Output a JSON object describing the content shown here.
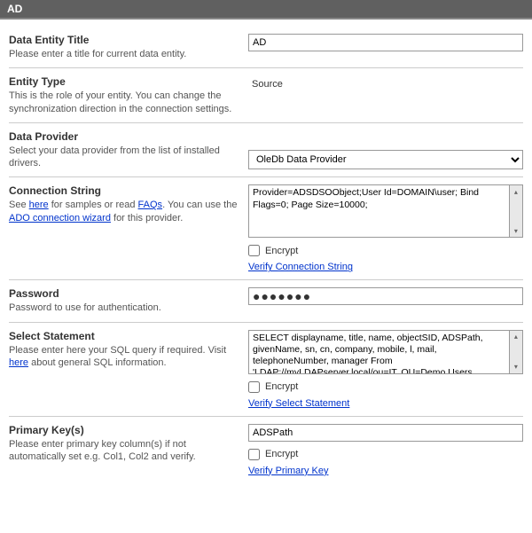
{
  "titleBar": "AD",
  "sections": {
    "dataEntityTitle": {
      "label": "Data Entity Title",
      "desc": "Please enter a title for current data entity.",
      "value": "AD"
    },
    "entityType": {
      "label": "Entity Type",
      "desc": "This is the role of your entity. You can change the synchronization direction in the connection settings.",
      "value": "Source"
    },
    "dataProvider": {
      "label": "Data Provider",
      "desc": "Select your data provider from the list of installed drivers.",
      "value": "OleDb Data Provider"
    },
    "connectionString": {
      "label": "Connection String",
      "descParts": {
        "see": "See ",
        "hereLink1": "here",
        "forSamples": " for samples or read ",
        "faqs": "FAQs",
        "youCanUse": ". You can use the ",
        "wizardLink": "ADO connection wizard",
        "forProvider": " for this provider."
      },
      "value": "Provider=ADSDSOObject;User Id=DOMAIN\\user; Bind Flags=0; Page Size=10000;",
      "encryptLabel": "Encrypt",
      "verifyLink": "Verify Connection String"
    },
    "password": {
      "label": "Password",
      "desc": "Password to use for authentication.",
      "value": "●●●●●●●"
    },
    "selectStatement": {
      "label": "Select Statement",
      "descParts": {
        "pre": "Please enter here your SQL query if required. Visit ",
        "hereLink": "here",
        "post": " about general SQL information."
      },
      "value": "SELECT displayname, title, name, objectSID, ADSPath, givenName, sn, cn, company, mobile, l, mail, telephoneNumber, manager From 'LDAP://myLDAPserver.local/ou=IT, OU=Demo Users,",
      "encryptLabel": "Encrypt",
      "verifyLink": "Verify Select Statement"
    },
    "primaryKeys": {
      "label": "Primary Key(s)",
      "desc": "Please enter primary key column(s) if not automatically set e.g. Col1, Col2 and verify.",
      "value": "ADSPath",
      "encryptLabel": "Encrypt",
      "verifyLink": "Verify Primary Key"
    }
  }
}
